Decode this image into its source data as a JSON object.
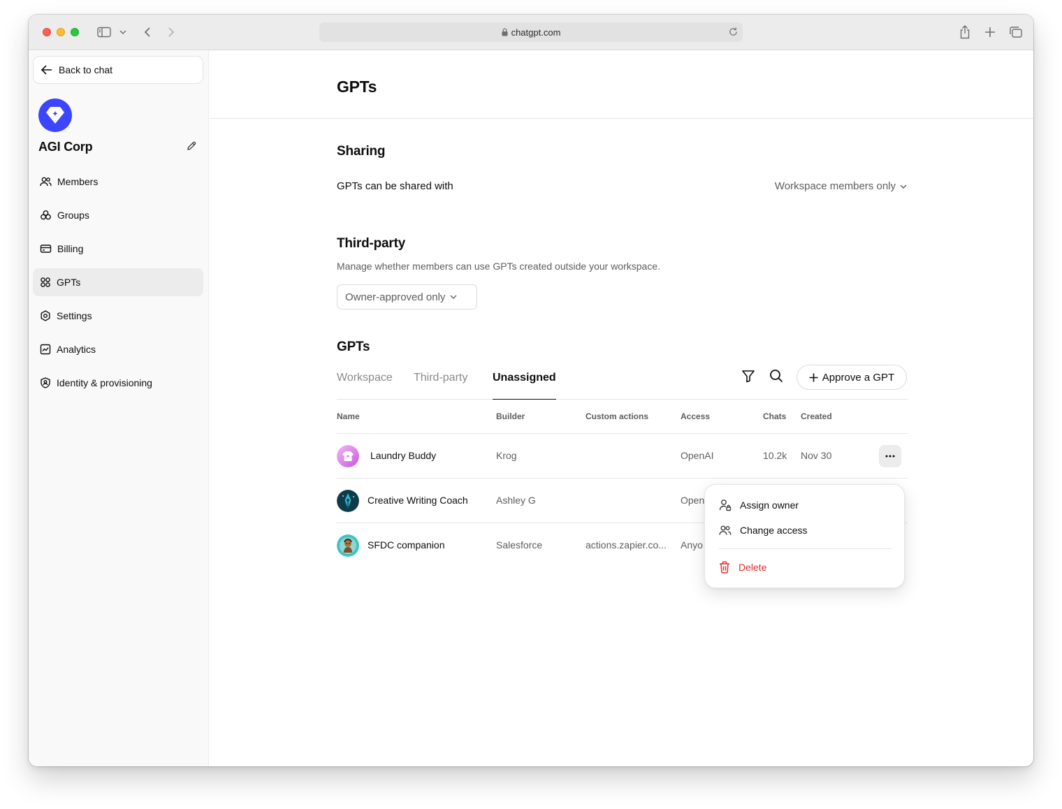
{
  "browser": {
    "url": "chatgpt.com"
  },
  "sidebar": {
    "back_label": "Back to chat",
    "workspace_name": "AGI Corp",
    "items": [
      {
        "label": "Members",
        "icon": "members-icon"
      },
      {
        "label": "Groups",
        "icon": "groups-icon"
      },
      {
        "label": "Billing",
        "icon": "billing-icon"
      },
      {
        "label": "GPTs",
        "icon": "gpts-icon",
        "active": true
      },
      {
        "label": "Settings",
        "icon": "settings-icon"
      },
      {
        "label": "Analytics",
        "icon": "analytics-icon"
      },
      {
        "label": "Identity & provisioning",
        "icon": "identity-icon"
      }
    ]
  },
  "main": {
    "title": "GPTs",
    "sharing": {
      "title": "Sharing",
      "label": "GPTs can be shared with",
      "value": "Workspace members only"
    },
    "third_party": {
      "title": "Third-party",
      "description": "Manage whether members can use GPTs created outside your workspace.",
      "value": "Owner-approved only"
    },
    "gpts": {
      "title": "GPTs",
      "tabs": [
        {
          "label": "Workspace",
          "active": false
        },
        {
          "label": "Third-party",
          "active": false
        },
        {
          "label": "Unassigned",
          "active": true
        }
      ],
      "approve_label": "Approve a GPT",
      "columns": [
        "Name",
        "Builder",
        "Custom actions",
        "Access",
        "Chats",
        "Created"
      ],
      "rows": [
        {
          "name": "Laundry Buddy",
          "builder": "Krog",
          "custom_actions": "",
          "access": "OpenAI",
          "chats": "10.2k",
          "created": "Nov 30"
        },
        {
          "name": "Creative Writing Coach",
          "builder": "Ashley G",
          "custom_actions": "",
          "access": "Open",
          "chats": "",
          "created": ""
        },
        {
          "name": "SFDC companion",
          "builder": "Salesforce",
          "custom_actions": "actions.zapier.co...",
          "access": "Anyo",
          "chats": "",
          "created": ""
        }
      ]
    },
    "context_menu": {
      "assign_owner": "Assign owner",
      "change_access": "Change access",
      "delete": "Delete"
    }
  },
  "colors": {
    "brand": "#3c46ff",
    "danger": "#e02e2a",
    "active_nav": "#ececec"
  }
}
